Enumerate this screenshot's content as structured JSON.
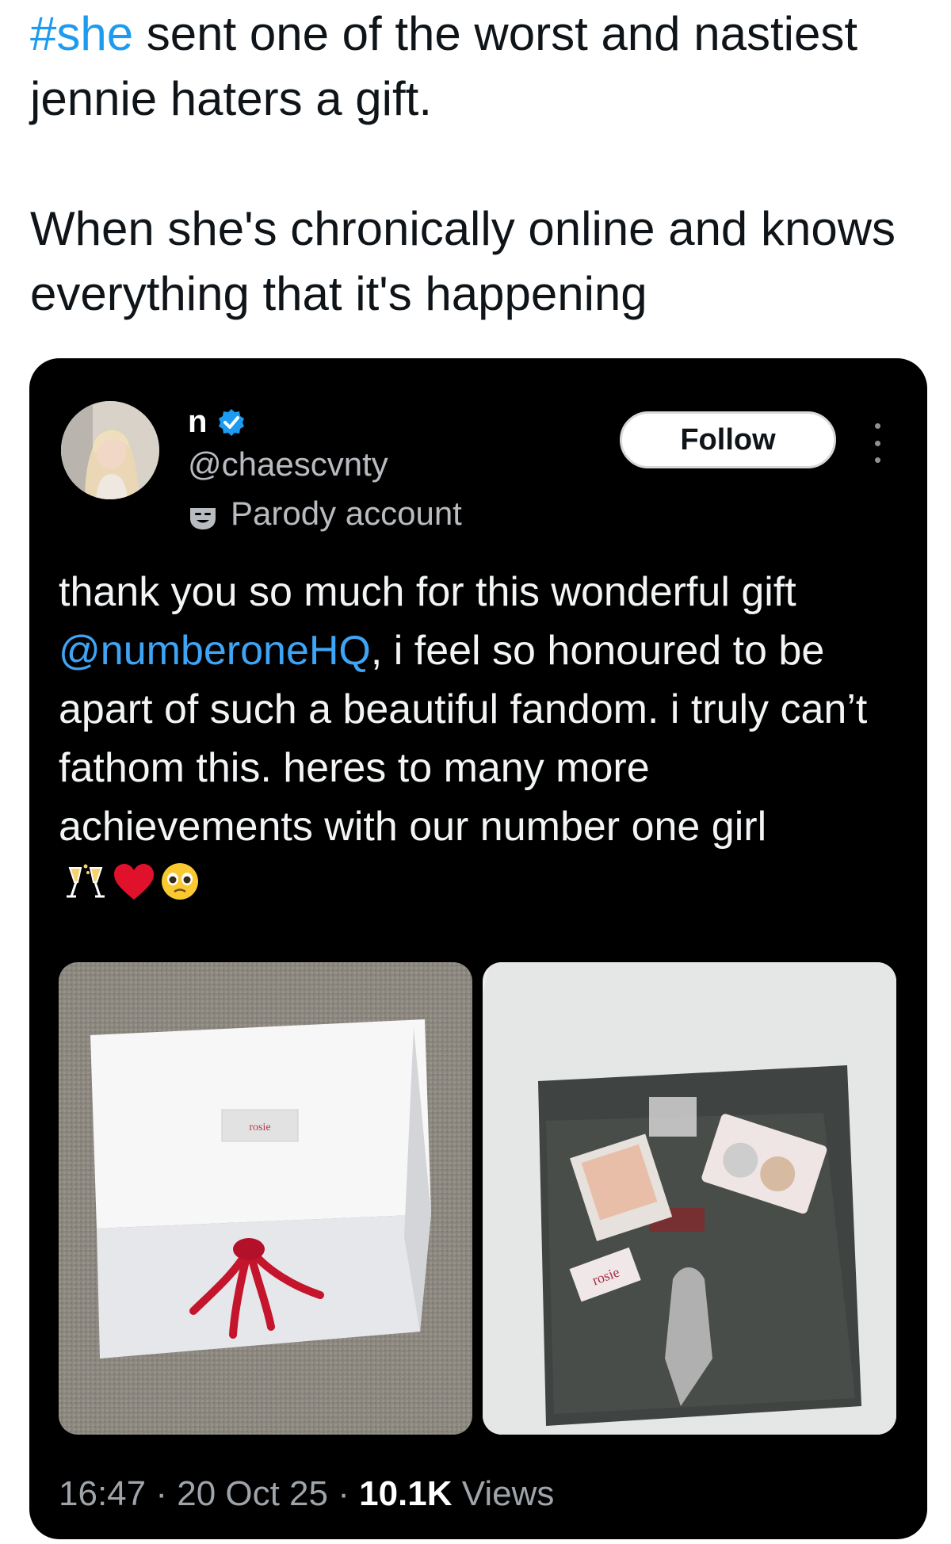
{
  "caption": {
    "hashtag": "#she",
    "line1_rest": " sent one of the worst and nastiest jennie haters a gift.",
    "line2": "When she's chronically online and knows everything that it's happening"
  },
  "tweet": {
    "display_name": "n",
    "handle": "@chaescvnty",
    "parody_label": "Parody account",
    "follow_label": "Follow",
    "text_before": "thank you so much for this wonderful gift ",
    "mention": "@numberoneHQ",
    "text_after": ", i feel so honoured to be apart of such a beautiful fandom. i truly can’t fathom this. heres to many more achievements with our number one girl",
    "emojis": [
      "champagne-icon",
      "heart-icon",
      "pleading-face-icon"
    ],
    "photos": [
      {
        "label_text": "rosie"
      },
      {
        "label_text": "rosie"
      }
    ],
    "time": "16:47",
    "date": "20 Oct 25",
    "views_count": "10.1K",
    "views_label": "Views",
    "separator": " · "
  },
  "colors": {
    "link": "#1d9bf0",
    "card_bg": "#000000",
    "verified": "#1d9bf0",
    "heart": "#e0112b"
  }
}
